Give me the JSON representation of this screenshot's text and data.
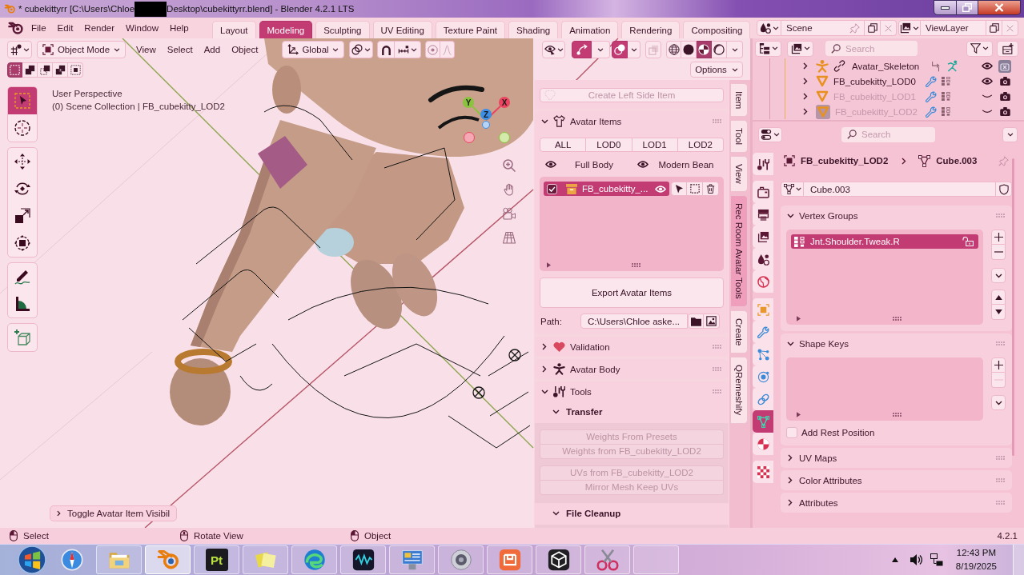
{
  "window": {
    "title_parts": [
      "* cubekittyrr [C:\\Users\\Chloe",
      "Desktop\\cubekittyrr.blend] - Blender 4.2.1 LTS"
    ]
  },
  "top_bar": {
    "menus": [
      "File",
      "Edit",
      "Render",
      "Window",
      "Help"
    ],
    "workspaces": [
      {
        "label": "Layout",
        "selected": false
      },
      {
        "label": "Modeling",
        "selected": true
      },
      {
        "label": "Sculpting",
        "selected": false
      },
      {
        "label": "UV Editing",
        "selected": false
      },
      {
        "label": "Texture Paint",
        "selected": false
      },
      {
        "label": "Shading",
        "selected": false
      },
      {
        "label": "Animation",
        "selected": false
      },
      {
        "label": "Rendering",
        "selected": false
      },
      {
        "label": "Compositing",
        "selected": false
      }
    ],
    "scene": "Scene",
    "view_layer": "ViewLayer"
  },
  "viewport": {
    "mode": "Object Mode",
    "menus": [
      "View",
      "Select",
      "Add",
      "Object"
    ],
    "orientation": "Global",
    "snapping": false,
    "proportional_editing": false,
    "gizmos": true,
    "overlays": true,
    "xray": false,
    "shading_modes": [
      {
        "selected": false
      },
      {
        "selected": false
      },
      {
        "selected": true
      },
      {
        "selected": false
      }
    ],
    "select_modes": [
      {
        "selected": true
      },
      {
        "selected": false
      },
      {
        "selected": false
      },
      {
        "selected": false
      },
      {
        "selected": false
      }
    ],
    "options": "Options",
    "tools": [
      {
        "selected": true
      },
      {
        "selected": false
      },
      {
        "selected": false
      },
      {
        "selected": false
      },
      {
        "selected": false
      },
      {
        "selected": false
      },
      {
        "selected": false
      },
      {
        "selected": false
      },
      {
        "selected": false
      }
    ],
    "view_name": "User Perspective",
    "collection": "(0) Scene Collection | FB_cubekitty_LOD2",
    "axes": [
      {
        "label": "Y",
        "color": "#8ac43e"
      },
      {
        "label": "Z",
        "color": "#3b8fe8"
      },
      {
        "label": "X",
        "color": "#ec4460"
      }
    ],
    "last_operation": "Toggle Avatar Item Visibil"
  },
  "sidebar": {
    "top_button": {
      "label": "Create Left Side Item",
      "disabled": true
    },
    "avatar_items": {
      "title": "Avatar Items",
      "expanded": true,
      "filters": [
        "ALL",
        "LOD0",
        "LOD1",
        "LOD2"
      ],
      "toggles": [
        "Full Body",
        "Modern Bean"
      ],
      "items": [
        {
          "name": "FB_cubekitty_...",
          "checked": true,
          "selected": true
        }
      ],
      "export_button": "Export Avatar Items",
      "path_label": "Path:",
      "path": "C:\\Users\\Chloe aske..."
    },
    "validation": {
      "title": "Validation",
      "expanded": false
    },
    "avatar_body": {
      "title": "Avatar Body",
      "expanded": false
    },
    "tools": {
      "title": "Tools",
      "expanded": true,
      "subpanels": [
        {
          "title": "Transfer",
          "expanded": true,
          "button_groups": [
            [
              {
                "label": "Weights From Presets",
                "disabled": true
              },
              {
                "label": "Weights from FB_cubekitty_LOD2",
                "disabled": true
              }
            ],
            [
              {
                "label": "UVs from FB_cubekitty_LOD2",
                "disabled": true
              },
              {
                "label": "Mirror Mesh Keep UVs",
                "disabled": true
              }
            ]
          ]
        },
        {
          "title": "File Cleanup",
          "expanded": true
        }
      ]
    },
    "tabs": [
      {
        "label": "Item",
        "selected": false
      },
      {
        "label": "Tool",
        "selected": false
      },
      {
        "label": "View",
        "selected": false
      },
      {
        "label": "Rec Room Avatar Tools",
        "selected": true
      },
      {
        "label": "Create",
        "selected": false
      },
      {
        "label": "QRemeshify",
        "selected": false
      }
    ]
  },
  "outliner": {
    "search_placeholder": "Search",
    "rows": [
      {
        "name": "Avatar_Skeleton",
        "kind": "armature",
        "visible": true,
        "renderable": false,
        "active": false
      },
      {
        "name": "FB_cubekitty_LOD0",
        "kind": "mesh",
        "visible": true,
        "renderable": true,
        "active": false
      },
      {
        "name": "FB_cubekitty_LOD1",
        "kind": "mesh",
        "visible": false,
        "renderable": true,
        "active": false
      },
      {
        "name": "FB_cubekitty_LOD2",
        "kind": "mesh",
        "visible": false,
        "renderable": true,
        "active": true
      }
    ]
  },
  "properties": {
    "search_placeholder": "Search",
    "tabs": [
      {
        "selected": false
      },
      {
        "selected": false
      },
      {
        "selected": false
      },
      {
        "selected": false
      },
      {
        "selected": false
      },
      {
        "selected": false
      },
      {
        "selected": false
      },
      {
        "selected": false
      },
      {
        "selected": false
      },
      {
        "selected": false
      },
      {
        "selected": false
      },
      {
        "selected": true
      },
      {
        "selected": false
      },
      {
        "selected": false
      }
    ],
    "object_name": "FB_cubekitty_LOD2",
    "data_name": "Cube.003",
    "mesh_field": "Cube.003",
    "vertex_groups": {
      "title": "Vertex Groups",
      "expanded": true,
      "items": [
        {
          "name": "Jnt.Shoulder.Tweak.R",
          "selected": true
        }
      ]
    },
    "shape_keys": {
      "title": "Shape Keys",
      "expanded": true,
      "remove_disabled": true
    },
    "add_rest_position": {
      "label": "Add Rest Position",
      "checked": false
    },
    "more_panels": [
      {
        "title": "UV Maps",
        "expanded": false
      },
      {
        "title": "Color Attributes",
        "expanded": false
      },
      {
        "title": "Attributes",
        "expanded": false
      }
    ]
  },
  "status_bar": {
    "hints": [
      "Select",
      "Rotate View",
      "Object"
    ],
    "version": "4.2.1"
  },
  "taskbar": {
    "apps": [
      {
        "active": false
      },
      {
        "active": true
      },
      {
        "label": "Pt",
        "active": false
      },
      {
        "active": false
      },
      {
        "active": false
      },
      {
        "active": false
      },
      {
        "active": false
      },
      {
        "active": false
      },
      {
        "active": false
      },
      {
        "active": false
      },
      {
        "active": false
      },
      {
        "active": false
      }
    ],
    "time": "12:43 PM",
    "date": "8/19/2025"
  }
}
